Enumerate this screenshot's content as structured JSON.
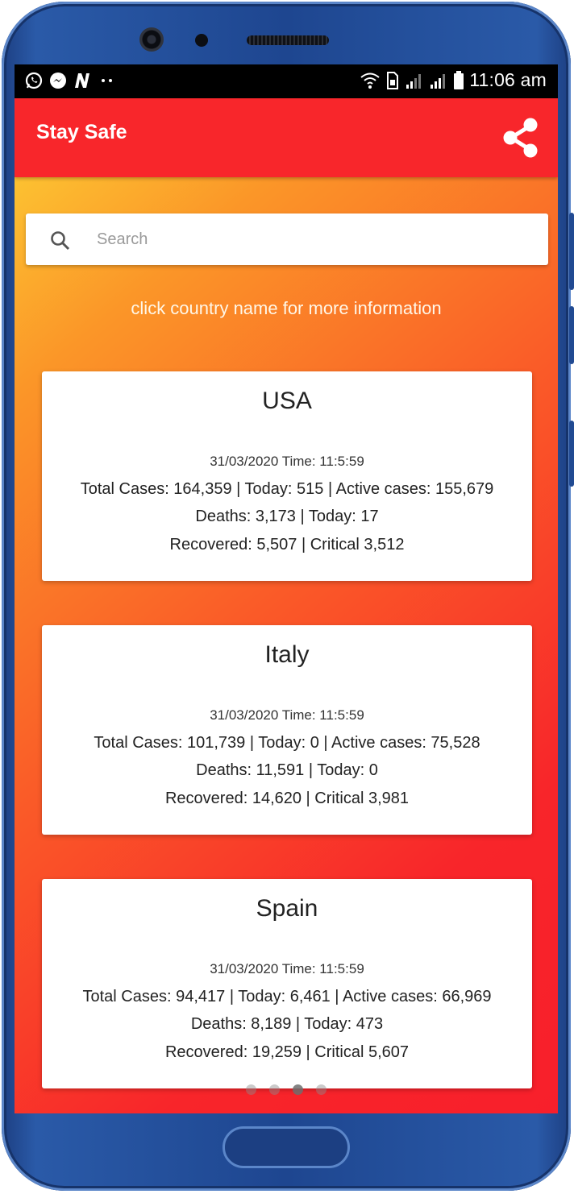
{
  "status_bar": {
    "time": "11:06 am",
    "left_icons": [
      "whatsapp-icon",
      "messenger-icon",
      "n-app-icon",
      "more-dots-icon"
    ],
    "right_icons": [
      "wifi-icon",
      "sim-icon",
      "signal-icon",
      "signal-icon",
      "battery-icon"
    ]
  },
  "app_bar": {
    "title": "Stay Safe",
    "share_icon": "share-icon"
  },
  "search": {
    "placeholder": "Search",
    "value": ""
  },
  "hint": "click country name for more information",
  "countries": [
    {
      "name": "USA",
      "date": "31/03/2020 Time: 11:5:59",
      "cases_line": "Total Cases: 164,359 | Today: 515 | Active cases: 155,679",
      "deaths_line": "Deaths: 3,173 | Today: 17",
      "recovered_line": "Recovered: 5,507 | Critical 3,512"
    },
    {
      "name": "Italy",
      "date": "31/03/2020 Time: 11:5:59",
      "cases_line": "Total Cases: 101,739 | Today: 0 | Active cases: 75,528",
      "deaths_line": "Deaths: 11,591 | Today: 0",
      "recovered_line": "Recovered: 14,620 | Critical 3,981"
    },
    {
      "name": "Spain",
      "date": "31/03/2020 Time: 11:5:59",
      "cases_line": "Total Cases: 94,417 | Today: 6,461 | Active cases: 66,969",
      "deaths_line": "Deaths: 8,189 | Today: 473",
      "recovered_line": "Recovered: 19,259 | Critical 5,607"
    }
  ],
  "page_indicator": {
    "count": 4,
    "active_index": 2
  },
  "colors": {
    "app_bar": "#f8262b",
    "gradient_top": "#fdd836",
    "gradient_bottom": "#f81f2b",
    "phone_frame": "#1e4690"
  }
}
